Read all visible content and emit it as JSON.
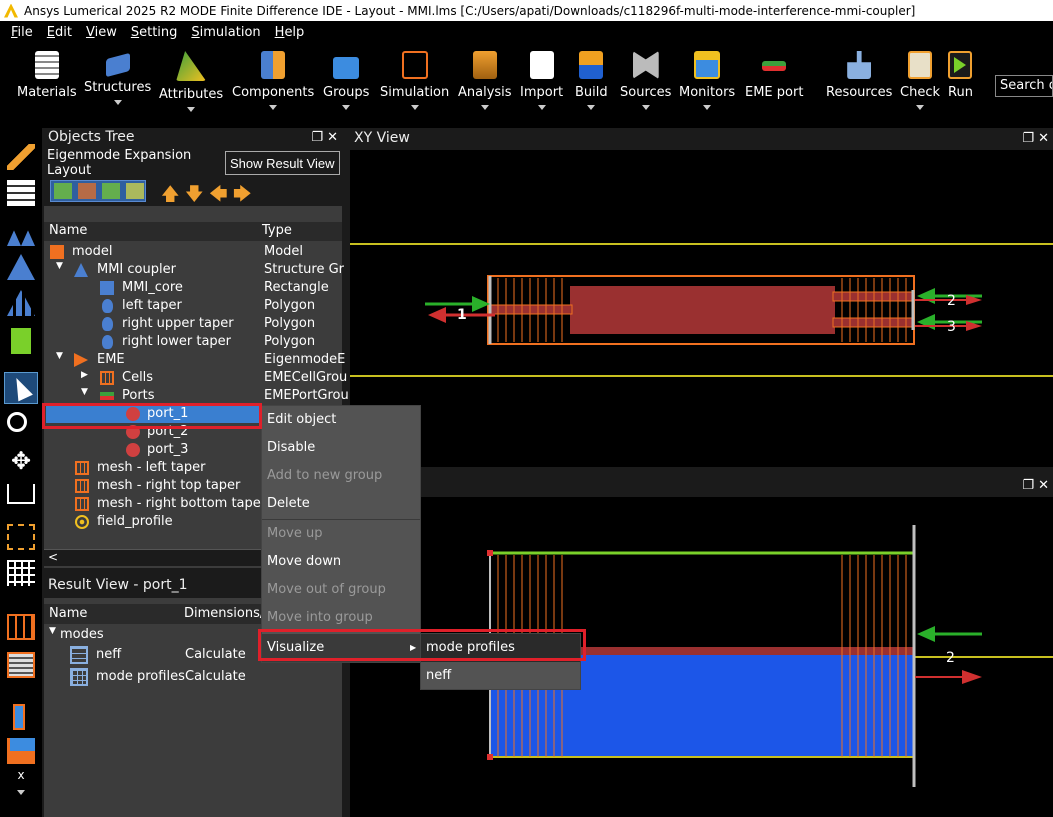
{
  "window": {
    "title": "Ansys Lumerical 2025 R2 MODE Finite Difference IDE - Layout - MMI.lms [C:/Users/apati/Downloads/c118296f-multi-mode-interference-mmi-coupler]"
  },
  "menu": [
    "File",
    "Edit",
    "View",
    "Setting",
    "Simulation",
    "Help"
  ],
  "toolbar": {
    "items": [
      {
        "label": "Materials",
        "icon": "materials-icon"
      },
      {
        "label": "Structures",
        "icon": "structures-icon"
      },
      {
        "label": "Attributes",
        "icon": "attributes-icon"
      },
      {
        "label": "Components",
        "icon": "components-icon"
      },
      {
        "label": "Groups",
        "icon": "groups-icon"
      },
      {
        "label": "Simulation",
        "icon": "simulation-icon"
      },
      {
        "label": "Analysis",
        "icon": "analysis-icon"
      },
      {
        "label": "Import",
        "icon": "import-icon"
      },
      {
        "label": "Build",
        "icon": "build-icon"
      },
      {
        "label": "Sources",
        "icon": "sources-icon"
      },
      {
        "label": "Monitors",
        "icon": "monitors-icon"
      },
      {
        "label": "EME port",
        "icon": "eme-port-icon"
      },
      {
        "label": "Resources",
        "icon": "resources-icon"
      },
      {
        "label": "Check",
        "icon": "check-icon"
      },
      {
        "label": "Run",
        "icon": "run-icon"
      }
    ],
    "search_placeholder": "Search on"
  },
  "objects_tree": {
    "title": "Objects Tree",
    "layout_label": "Eigenmode Expansion Layout",
    "show_result_button": "Show Result View",
    "columns": {
      "name": "Name",
      "type": "Type"
    },
    "rows": [
      {
        "name": "model",
        "type": "Model"
      },
      {
        "name": "MMI coupler",
        "type": "Structure Gr"
      },
      {
        "name": "MMI_core",
        "type": "Rectangle"
      },
      {
        "name": "left taper",
        "type": "Polygon"
      },
      {
        "name": "right upper taper",
        "type": "Polygon"
      },
      {
        "name": "right lower taper",
        "type": "Polygon"
      },
      {
        "name": "EME",
        "type": "EigenmodeE"
      },
      {
        "name": "Cells",
        "type": "EMECellGrou"
      },
      {
        "name": "Ports",
        "type": "EMEPortGrou"
      },
      {
        "name": "port_1",
        "type": ""
      },
      {
        "name": "port_2",
        "type": ""
      },
      {
        "name": "port_3",
        "type": ""
      },
      {
        "name": "mesh - left taper",
        "type": ""
      },
      {
        "name": "mesh - right top taper",
        "type": ""
      },
      {
        "name": "mesh - right bottom taper",
        "type": ""
      },
      {
        "name": "field_profile",
        "type": ""
      }
    ]
  },
  "result_view": {
    "title": "Result View - port_1",
    "columns": {
      "name": "Name",
      "dims": "Dimensions/V"
    },
    "group": "modes",
    "rows": [
      {
        "name": "neff",
        "value": "Calculate"
      },
      {
        "name": "mode profiles",
        "value": "Calculate"
      }
    ]
  },
  "xy_view": {
    "title": "XY View",
    "port_labels": [
      "1",
      "2",
      "3"
    ]
  },
  "lower_view": {
    "port_label": "2"
  },
  "context_menu": {
    "items": [
      {
        "label": "Edit object",
        "enabled": true
      },
      {
        "label": "Disable",
        "enabled": true
      },
      {
        "label": "Add to new group",
        "enabled": false
      },
      {
        "label": "Delete",
        "enabled": true
      },
      {
        "label": "Move up",
        "enabled": false
      },
      {
        "label": "Move down",
        "enabled": true
      },
      {
        "label": "Move out of group",
        "enabled": false
      },
      {
        "label": "Move into group",
        "enabled": false
      },
      {
        "label": "Visualize",
        "enabled": true
      }
    ],
    "submenu": [
      "mode profiles",
      "neff"
    ]
  }
}
